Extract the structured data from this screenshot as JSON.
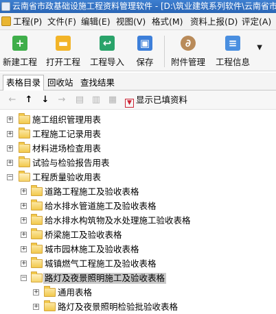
{
  "window": {
    "title": "云南省市政基础设施工程资料管理软件 - [D:\\筑业建筑系列软件\\云南省市"
  },
  "menu": {
    "items": [
      {
        "label": "工程(P)"
      },
      {
        "label": "文件(F)"
      },
      {
        "label": "编辑(E)"
      },
      {
        "label": "视图(V)"
      },
      {
        "label": "格式(M)"
      },
      {
        "label": "资料上报(D)"
      },
      {
        "label": "评定(A)"
      }
    ]
  },
  "toolbar": {
    "buttons": [
      {
        "label": "新建工程",
        "icon": "new-project-icon",
        "color": "#3fae4a"
      },
      {
        "label": "打开工程",
        "icon": "open-folder-icon",
        "color": "#f2b428"
      },
      {
        "label": "工程导入",
        "icon": "import-icon",
        "color": "#2aa36a"
      },
      {
        "label": "保存",
        "icon": "save-icon",
        "color": "#3d7fd9"
      },
      {
        "label": "附件管理",
        "icon": "paperclip-icon",
        "color": "#b98b5a"
      },
      {
        "label": "工程信息",
        "icon": "info-doc-icon",
        "color": "#4a8fe0"
      }
    ]
  },
  "tabs": [
    {
      "label": "表格目录",
      "active": true
    },
    {
      "label": "回收站",
      "active": false
    },
    {
      "label": "查找结果",
      "active": false
    }
  ],
  "subtoolbar": {
    "filter_label": "显示已填资料"
  },
  "tree": {
    "nodes": [
      {
        "label": "施工组织管理用表",
        "level": 0,
        "expanded": false
      },
      {
        "label": "工程施工记录用表",
        "level": 0,
        "expanded": false
      },
      {
        "label": "材料进场检查用表",
        "level": 0,
        "expanded": false
      },
      {
        "label": "试验与检验报告用表",
        "level": 0,
        "expanded": false
      },
      {
        "label": "工程质量验收用表",
        "level": 0,
        "expanded": true
      },
      {
        "label": "道路工程施工及验收表格",
        "level": 1,
        "expanded": false
      },
      {
        "label": "给水排水管道施工及验收表格",
        "level": 1,
        "expanded": false
      },
      {
        "label": "给水排水构筑物及水处理施工验收表格",
        "level": 1,
        "expanded": false
      },
      {
        "label": "桥梁施工及验收表格",
        "level": 1,
        "expanded": false
      },
      {
        "label": "城市园林施工及验收表格",
        "level": 1,
        "expanded": false
      },
      {
        "label": "城镇燃气工程施工及验收表格",
        "level": 1,
        "expanded": false
      },
      {
        "label": "路灯及夜景照明施工及验收表格",
        "level": 1,
        "expanded": true,
        "selected": true
      },
      {
        "label": "通用表格",
        "level": 2,
        "expanded": false
      },
      {
        "label": "路灯及夜景照明检验批验收表格",
        "level": 2,
        "expanded": false
      }
    ]
  }
}
